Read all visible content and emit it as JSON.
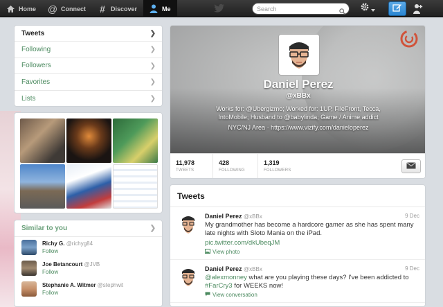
{
  "topbar": {
    "nav": [
      {
        "label": "Home",
        "icon": "home-icon"
      },
      {
        "label": "Connect",
        "icon": "at-icon"
      },
      {
        "label": "Discover",
        "icon": "hash-icon"
      },
      {
        "label": "Me",
        "icon": "person-icon",
        "active": true
      }
    ],
    "search_placeholder": "Search"
  },
  "sidebar": {
    "menu": [
      {
        "label": "Tweets",
        "active": true
      },
      {
        "label": "Following"
      },
      {
        "label": "Followers"
      },
      {
        "label": "Favorites"
      },
      {
        "label": "Lists"
      }
    ]
  },
  "similar": {
    "title": "Similar to you",
    "people": [
      {
        "name": "Richy G.",
        "handle": "@richyg84",
        "follow": "Follow"
      },
      {
        "name": "Joe Betancourt",
        "handle": "@JVB",
        "follow": "Follow"
      },
      {
        "name": "Stephanie A. Witmer",
        "handle": "@stephwit",
        "follow": "Follow"
      }
    ]
  },
  "profile": {
    "name": "Daniel Perez",
    "handle": "@xBBx",
    "bio_line1": "Works for: @Ubergizmo; Worked for: 1UP, FileFront, Tecca,",
    "bio_line2": "IntoMobile; Husband to @babylinda; Game / Anime addict",
    "location": "NYC/NJ Area · https://www.vizify.com/danieloperez",
    "stats": [
      {
        "value": "11,978",
        "label": "TWEETS"
      },
      {
        "value": "428",
        "label": "FOLLOWING"
      },
      {
        "value": "1,319",
        "label": "FOLLOWERS"
      }
    ]
  },
  "tweets": {
    "title": "Tweets",
    "items": [
      {
        "name": "Daniel Perez",
        "handle": "@xBBx",
        "date": "9 Dec",
        "text": "My grandmother has become a hardcore gamer as she has spent many late nights with Sloto Mania on the iPad.",
        "link": "pic.twitter.com/dkUbeqJM",
        "meta": "View photo"
      },
      {
        "name": "Daniel Perez",
        "handle": "@xBBx",
        "date": "9 Dec",
        "mention": "@alexmonney",
        "text": " what are you playing these days? I've been addicted to ",
        "hashtag": "#FarCry3",
        "text2": " for WEEKS now!",
        "meta": "View conversation"
      }
    ]
  },
  "colors": {
    "accent": "#4b8a5f",
    "topbar": "#2a2a2a",
    "compose": "#2a86d2"
  }
}
